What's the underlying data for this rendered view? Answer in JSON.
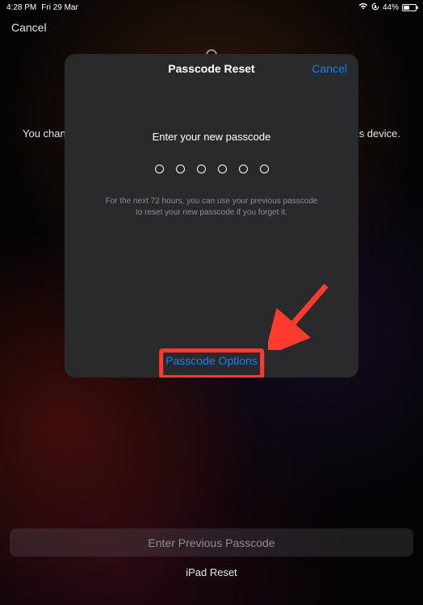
{
  "status_bar": {
    "time": "4:28 PM",
    "date": "Fri 29 Mar",
    "battery_percent": "44%"
  },
  "outer": {
    "cancel": "Cancel",
    "bg_text_left": "You change",
    "bg_text_right": "his device.",
    "enter_previous": "Enter Previous Passcode",
    "ipad_reset": "iPad Reset"
  },
  "modal": {
    "title": "Passcode Reset",
    "cancel": "Cancel",
    "prompt": "Enter your new passcode",
    "hint": "For the next 72 hours, you can use your previous passcode to reset your new passcode if you forget it.",
    "passcode_options": "Passcode Options",
    "passcode_length": 6
  }
}
